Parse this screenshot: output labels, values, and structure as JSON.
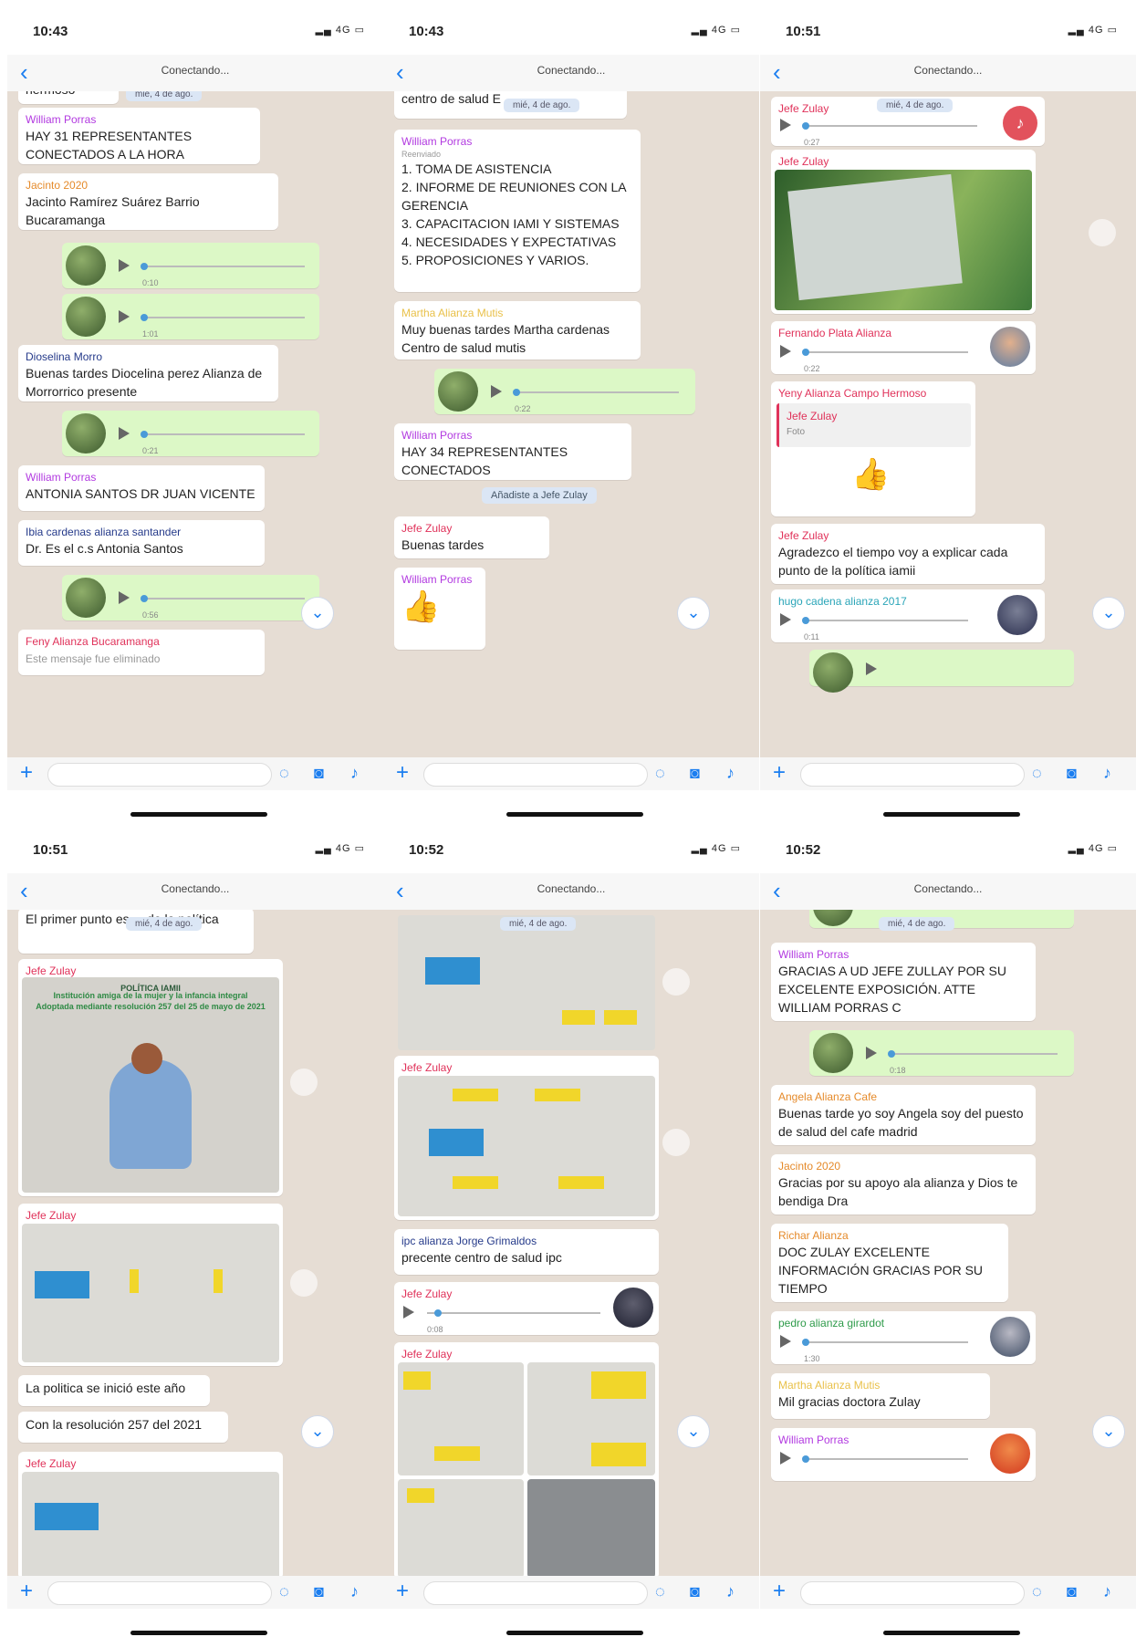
{
  "common": {
    "back": "‹",
    "connecting": "Conectando...",
    "date_chip": "mié, 4 de ago.",
    "plus": "+",
    "scroll_down": "⌄",
    "sticker_label": "Foto",
    "icons": {
      "sticker": "◌",
      "camera": "◙",
      "mic": "♪"
    }
  },
  "s1": {
    "time": "10:43",
    "signal": "▂▄ 4G ▭",
    "m0": "hermoso",
    "m1_sender": "William Porras",
    "m1_text": "HAY 31 REPRESENTANTES CONECTADOS A LA HORA",
    "m2_sender": "Jacinto 2020",
    "m2_text": "Jacinto Ramírez Suárez Barrio Bucaramanga",
    "a1_dur": "0:10",
    "a2_dur": "1:01",
    "m3_sender": "Dioselina Morro",
    "m3_text": "Buenas tardes Diocelina perez Alianza de Morrorrico presente",
    "a3_dur": "0:21",
    "m4_sender": "William Porras",
    "m4_text": "ANTONIA SANTOS DR JUAN VICENTE",
    "m5_sender": "Ibia cardenas alianza santander",
    "m5_text": "Dr. Es el c.s Antonia Santos",
    "a4_dur": "0:56",
    "m6_sender": "Feny Alianza Bucaramanga",
    "m6_text": "Este mensaje fue eliminado"
  },
  "s2": {
    "time": "10:43",
    "signal": "▂▄ 4G ▭",
    "m0": "centro de salud E",
    "m1_sender": "William Porras",
    "m1_fwd": "Reenviado",
    "m1_lines": [
      "1. TOMA DE ASISTENCIA",
      "2. INFORME DE REUNIONES CON LA GERENCIA",
      "3. CAPACITACION IAMI Y SISTEMAS",
      "4. NECESIDADES Y EXPECTATIVAS",
      "5. PROPOSICIONES Y VARIOS."
    ],
    "m2_sender": "Martha Alianza Mutis",
    "m2_text": "Muy buenas tardes Martha cardenas Centro de salud mutis",
    "a1_dur": "0:22",
    "m3_sender": "William Porras",
    "m3_text": "HAY 34 REPRESENTANTES CONECTADOS",
    "sys": "Añadiste a Jefe Zulay",
    "m4_sender": "Jefe Zulay",
    "m4_text": "Buenas tardes",
    "m5_sender": "William Porras",
    "m5_emoji": "👍"
  },
  "s3": {
    "time": "10:51",
    "signal": "▂▄ 4G ▭",
    "m1_sender": "Jefe Zulay",
    "m1_dur": "0:27",
    "m2_sender": "Jefe Zulay",
    "m3_sender": "Fernando Plata Alianza",
    "m3_dur": "0:22",
    "m4_sender": "Yeny Alianza Campo Hermoso",
    "m4_quote": "Jefe Zulay",
    "m4_emoji": "👍",
    "m5_sender": "Jefe Zulay",
    "m5_text": "Agradezco el tiempo voy a explicar cada punto de la política iamii",
    "m6_sender": "hugo cadena alianza 2017",
    "m6_dur": "0:11"
  },
  "s4": {
    "time": "10:51",
    "signal": "▂▄ 4G ▭",
    "m0": "El primer punto es ... de la política",
    "m1_sender": "Jefe Zulay",
    "m1_title": "POLÍTICA IAMII",
    "m1_caption": "Institución amiga de la mujer y la infancia integral Adoptada mediante resolución 257 del 25 de mayo de 2021",
    "m2_sender": "Jefe Zulay",
    "m3_text": "La politica se inició este año",
    "m4_text": "Con la resolución 257 del 2021",
    "m5_sender": "Jefe Zulay"
  },
  "s5": {
    "time": "10:52",
    "signal": "▂▄ 4G ▭",
    "m1_sender": "Jefe Zulay",
    "m2_sender": "ipc alianza Jorge Grimaldos",
    "m2_text": "precente centro de salud ipc",
    "m3_sender": "Jefe Zulay",
    "m3_dur": "0:08",
    "m4_sender": "Jefe Zulay"
  },
  "s6": {
    "time": "10:52",
    "signal": "▂▄ 4G ▭",
    "m1_sender": "William Porras",
    "m1_text": "GRACIAS A UD JEFE ZULLAY POR SU EXCELENTE EXPOSICIÓN. ATTE WILLIAM PORRAS C",
    "a1_dur": "0:18",
    "m2_sender": "Angela Alianza Cafe",
    "m2_text": "Buenas tarde yo soy Angela soy del puesto de salud del cafe madrid",
    "m3_sender": "Jacinto 2020",
    "m3_text": "Gracias por su apoyo ala alianza y Dios te bendiga Dra",
    "m4_sender": "Richar Alianza",
    "m4_text": "DOC ZULAY EXCELENTE INFORMACIÓN GRACIAS POR SU TIEMPO",
    "m5_sender": "pedro alianza girardot",
    "m5_dur": "1:30",
    "m6_sender": "Martha Alianza Mutis",
    "m6_text": "Mil gracias doctora Zulay",
    "m7_sender": "William Porras"
  }
}
